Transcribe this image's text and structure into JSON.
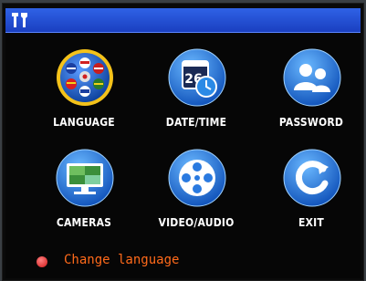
{
  "menu": {
    "items": [
      {
        "label": "LANGUAGE",
        "icon": "language-flags-icon"
      },
      {
        "label": "DATE/TIME",
        "icon": "calendar-clock-icon",
        "calendar_day": "26"
      },
      {
        "label": "PASSWORD",
        "icon": "users-icon"
      },
      {
        "label": "CAMERAS",
        "icon": "monitor-icon"
      },
      {
        "label": "VIDEO/AUDIO",
        "icon": "film-reel-icon"
      },
      {
        "label": "EXIT",
        "icon": "exit-arrow-icon"
      }
    ],
    "selected_index": 0
  },
  "status_bar": {
    "text": "Change  language",
    "dot_color": "#e02020",
    "text_color": "#ff6a1a"
  },
  "colors": {
    "title_bar": "#2450d8",
    "icon_blue": "#1f6fd6",
    "selection_glow": "#f4c21a"
  }
}
